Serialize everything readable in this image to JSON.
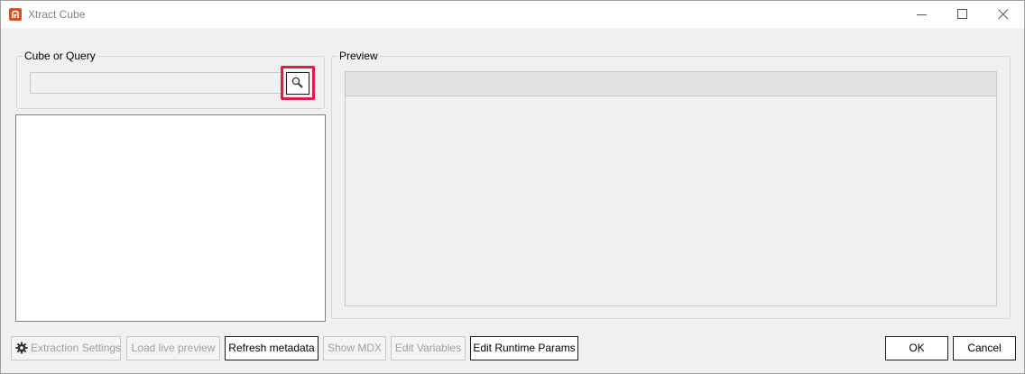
{
  "window": {
    "title": "Xtract Cube",
    "controls": {
      "minimize_icon": "minimize-icon",
      "maximize_icon": "maximize-icon",
      "close_icon": "close-icon"
    }
  },
  "cube_group": {
    "legend": "Cube or Query",
    "input_value": "",
    "search_icon": "search-icon"
  },
  "preview_group": {
    "legend": "Preview"
  },
  "buttons": {
    "extraction_settings": "Extraction Settings",
    "load_live_preview": "Load live preview",
    "refresh_metadata": "Refresh metadata",
    "show_mdx": "Show MDX",
    "edit_variables": "Edit Variables",
    "edit_runtime_params": "Edit Runtime Params",
    "ok": "OK",
    "cancel": "Cancel"
  },
  "colors": {
    "app_icon": "#d9531e",
    "highlight": "#d4204d"
  }
}
